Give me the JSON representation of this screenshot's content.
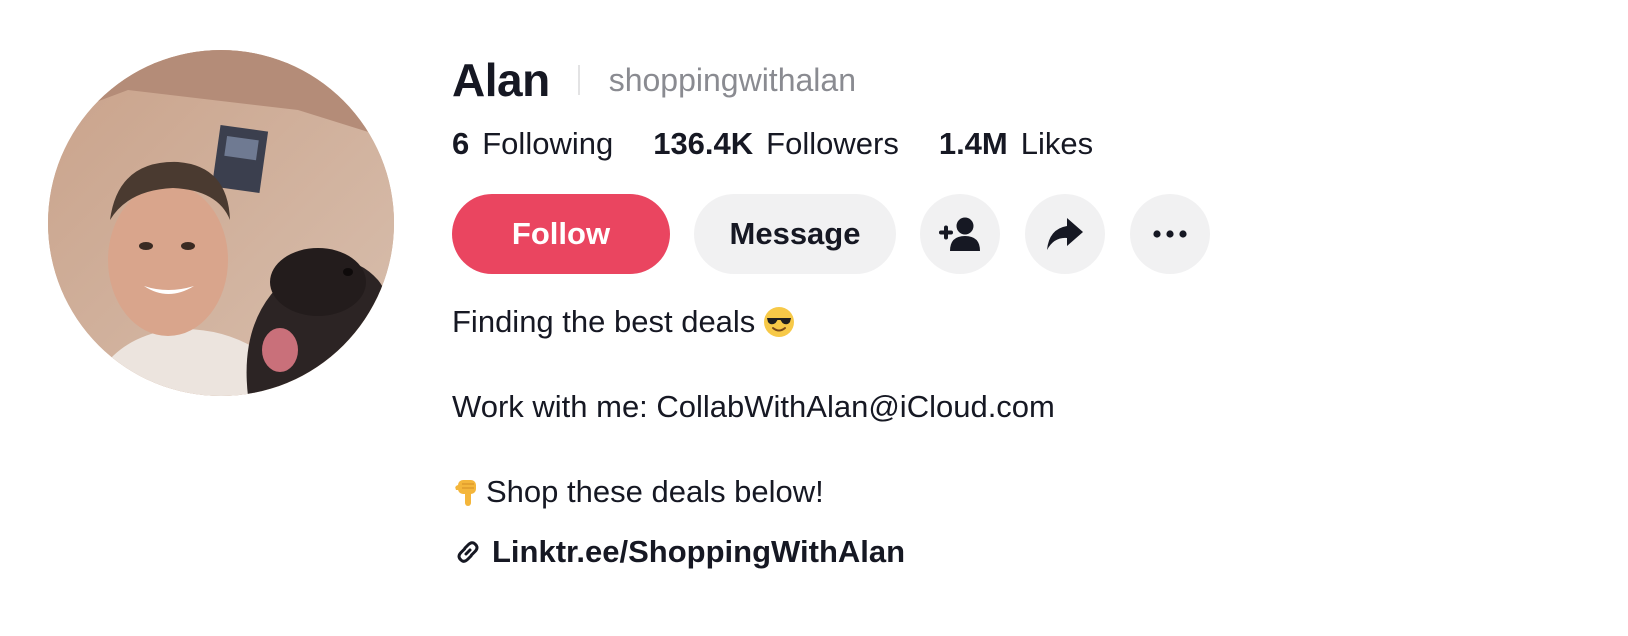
{
  "profile": {
    "display_name": "Alan",
    "username": "shoppingwithalan",
    "stats": [
      {
        "value": "6",
        "label": "Following"
      },
      {
        "value": "136.4K",
        "label": "Followers"
      },
      {
        "value": "1.4M",
        "label": "Likes"
      }
    ],
    "actions": {
      "follow_label": "Follow",
      "message_label": "Message",
      "add_friend_icon": "person-plus-icon",
      "share_icon": "share-arrow-icon",
      "more_icon": "more-dots-icon"
    },
    "bio": {
      "line1": "Finding the best deals",
      "line1_emoji": "smiling-face-with-sunglasses",
      "line2": "Work with me: CollabWithAlan@iCloud.com",
      "line3": "Shop these deals below!",
      "line3_emoji": "backhand-index-pointing-down"
    },
    "link": {
      "text": "Linktr.ee/ShoppingWithAlan",
      "icon": "link-icon"
    }
  },
  "colors": {
    "follow_button": "#ea4560",
    "secondary_button": "#f1f1f2",
    "text": "#161823",
    "muted_text": "#8a8b91"
  }
}
